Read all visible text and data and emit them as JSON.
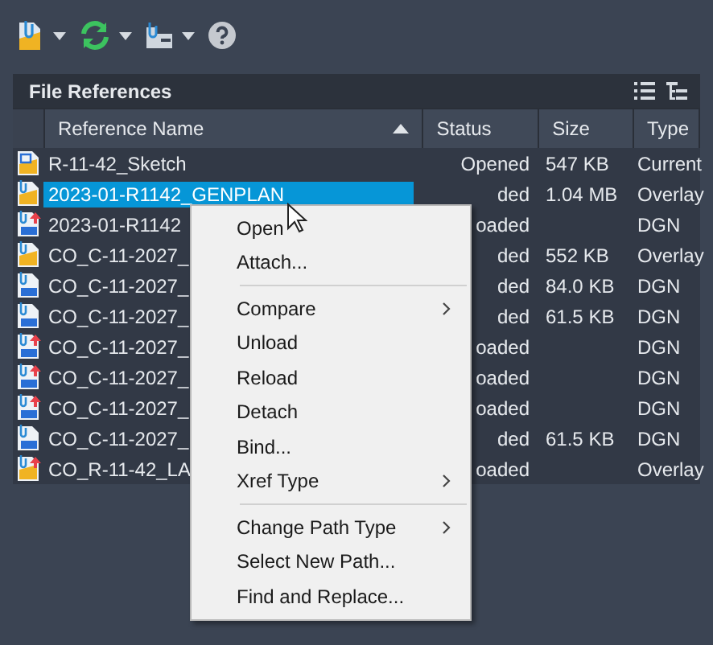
{
  "toolbar": [
    {
      "kind": "attach",
      "dropdown": true
    },
    {
      "kind": "refresh",
      "dropdown": true
    },
    {
      "kind": "path",
      "dropdown": true
    },
    {
      "kind": "help",
      "dropdown": false
    }
  ],
  "panel": {
    "title": "File References"
  },
  "table": {
    "columns": [
      {
        "label": "Reference Name",
        "sorted": true
      },
      {
        "label": "Status",
        "sorted": false
      },
      {
        "label": "Size",
        "sorted": false
      },
      {
        "label": "Type",
        "sorted": false
      }
    ],
    "rows": [
      {
        "kind": "current",
        "unloaded": false,
        "selected": false,
        "name": "R-11-42_Sketch",
        "status": "Opened",
        "size": "547 KB",
        "type": "Current"
      },
      {
        "kind": "dwg",
        "unloaded": false,
        "selected": true,
        "name": "2023-01-R1142_GENPLAN",
        "status": "ded",
        "size": "1.04 MB",
        "type": "Overlay"
      },
      {
        "kind": "dgn",
        "unloaded": true,
        "selected": false,
        "name": "2023-01-R1142",
        "status": "oaded",
        "size": "",
        "type": "DGN"
      },
      {
        "kind": "dwg",
        "unloaded": false,
        "selected": false,
        "name": "CO_C-11-2027_",
        "status": "ded",
        "size": "552 KB",
        "type": "Overlay"
      },
      {
        "kind": "dgn",
        "unloaded": false,
        "selected": false,
        "name": "CO_C-11-2027_",
        "status": "ded",
        "size": "84.0 KB",
        "type": "DGN"
      },
      {
        "kind": "dgn",
        "unloaded": false,
        "selected": false,
        "name": "CO_C-11-2027_",
        "status": "ded",
        "size": "61.5 KB",
        "type": "DGN"
      },
      {
        "kind": "dgn",
        "unloaded": true,
        "selected": false,
        "name": "CO_C-11-2027_",
        "status": "oaded",
        "size": "",
        "type": "DGN"
      },
      {
        "kind": "dgn",
        "unloaded": true,
        "selected": false,
        "name": "CO_C-11-2027_",
        "status": "oaded",
        "size": "",
        "type": "DGN"
      },
      {
        "kind": "dgn",
        "unloaded": true,
        "selected": false,
        "name": "CO_C-11-2027_",
        "status": "oaded",
        "size": "",
        "type": "DGN"
      },
      {
        "kind": "dgn",
        "unloaded": false,
        "selected": false,
        "name": "CO_C-11-2027_",
        "status": "ded",
        "size": "61.5 KB",
        "type": "DGN"
      },
      {
        "kind": "dwg",
        "unloaded": true,
        "selected": false,
        "name": "CO_R-11-42_LA",
        "status": "oaded",
        "size": "",
        "type": "Overlay"
      }
    ]
  },
  "context_menu": [
    {
      "kind": "item",
      "label": "Open",
      "submenu": false
    },
    {
      "kind": "item",
      "label": "Attach...",
      "submenu": false
    },
    {
      "kind": "separator"
    },
    {
      "kind": "item",
      "label": "Compare",
      "submenu": true
    },
    {
      "kind": "item",
      "label": "Unload",
      "submenu": false
    },
    {
      "kind": "item",
      "label": "Reload",
      "submenu": false
    },
    {
      "kind": "item",
      "label": "Detach",
      "submenu": false
    },
    {
      "kind": "item",
      "label": "Bind...",
      "submenu": false
    },
    {
      "kind": "item",
      "label": "Xref Type",
      "submenu": true
    },
    {
      "kind": "separator"
    },
    {
      "kind": "item",
      "label": "Change Path Type",
      "submenu": true
    },
    {
      "kind": "item",
      "label": "Select New Path...",
      "submenu": false
    },
    {
      "kind": "item",
      "label": "Find and Replace...",
      "submenu": false
    }
  ]
}
